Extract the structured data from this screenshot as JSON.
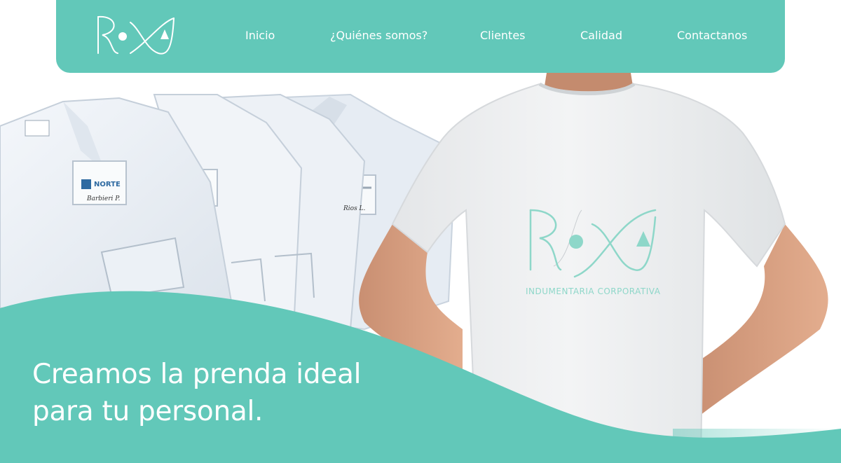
{
  "brand": {
    "name": "ROXA",
    "tagline": "INDUMENTARIA CORPORATIVA",
    "color": "#62c8b9"
  },
  "nav": {
    "items": [
      {
        "label": "Inicio"
      },
      {
        "label": "¿Quiénes somos?"
      },
      {
        "label": "Clientes"
      },
      {
        "label": "Calidad"
      },
      {
        "label": "Contactanos"
      }
    ]
  },
  "hero": {
    "headline_line1": "Creamos la prenda ideal",
    "headline_line2": "para tu personal.",
    "uniform_badge": "NORTE",
    "uniform_names": [
      "Barbieri P.",
      "Rios L."
    ]
  }
}
